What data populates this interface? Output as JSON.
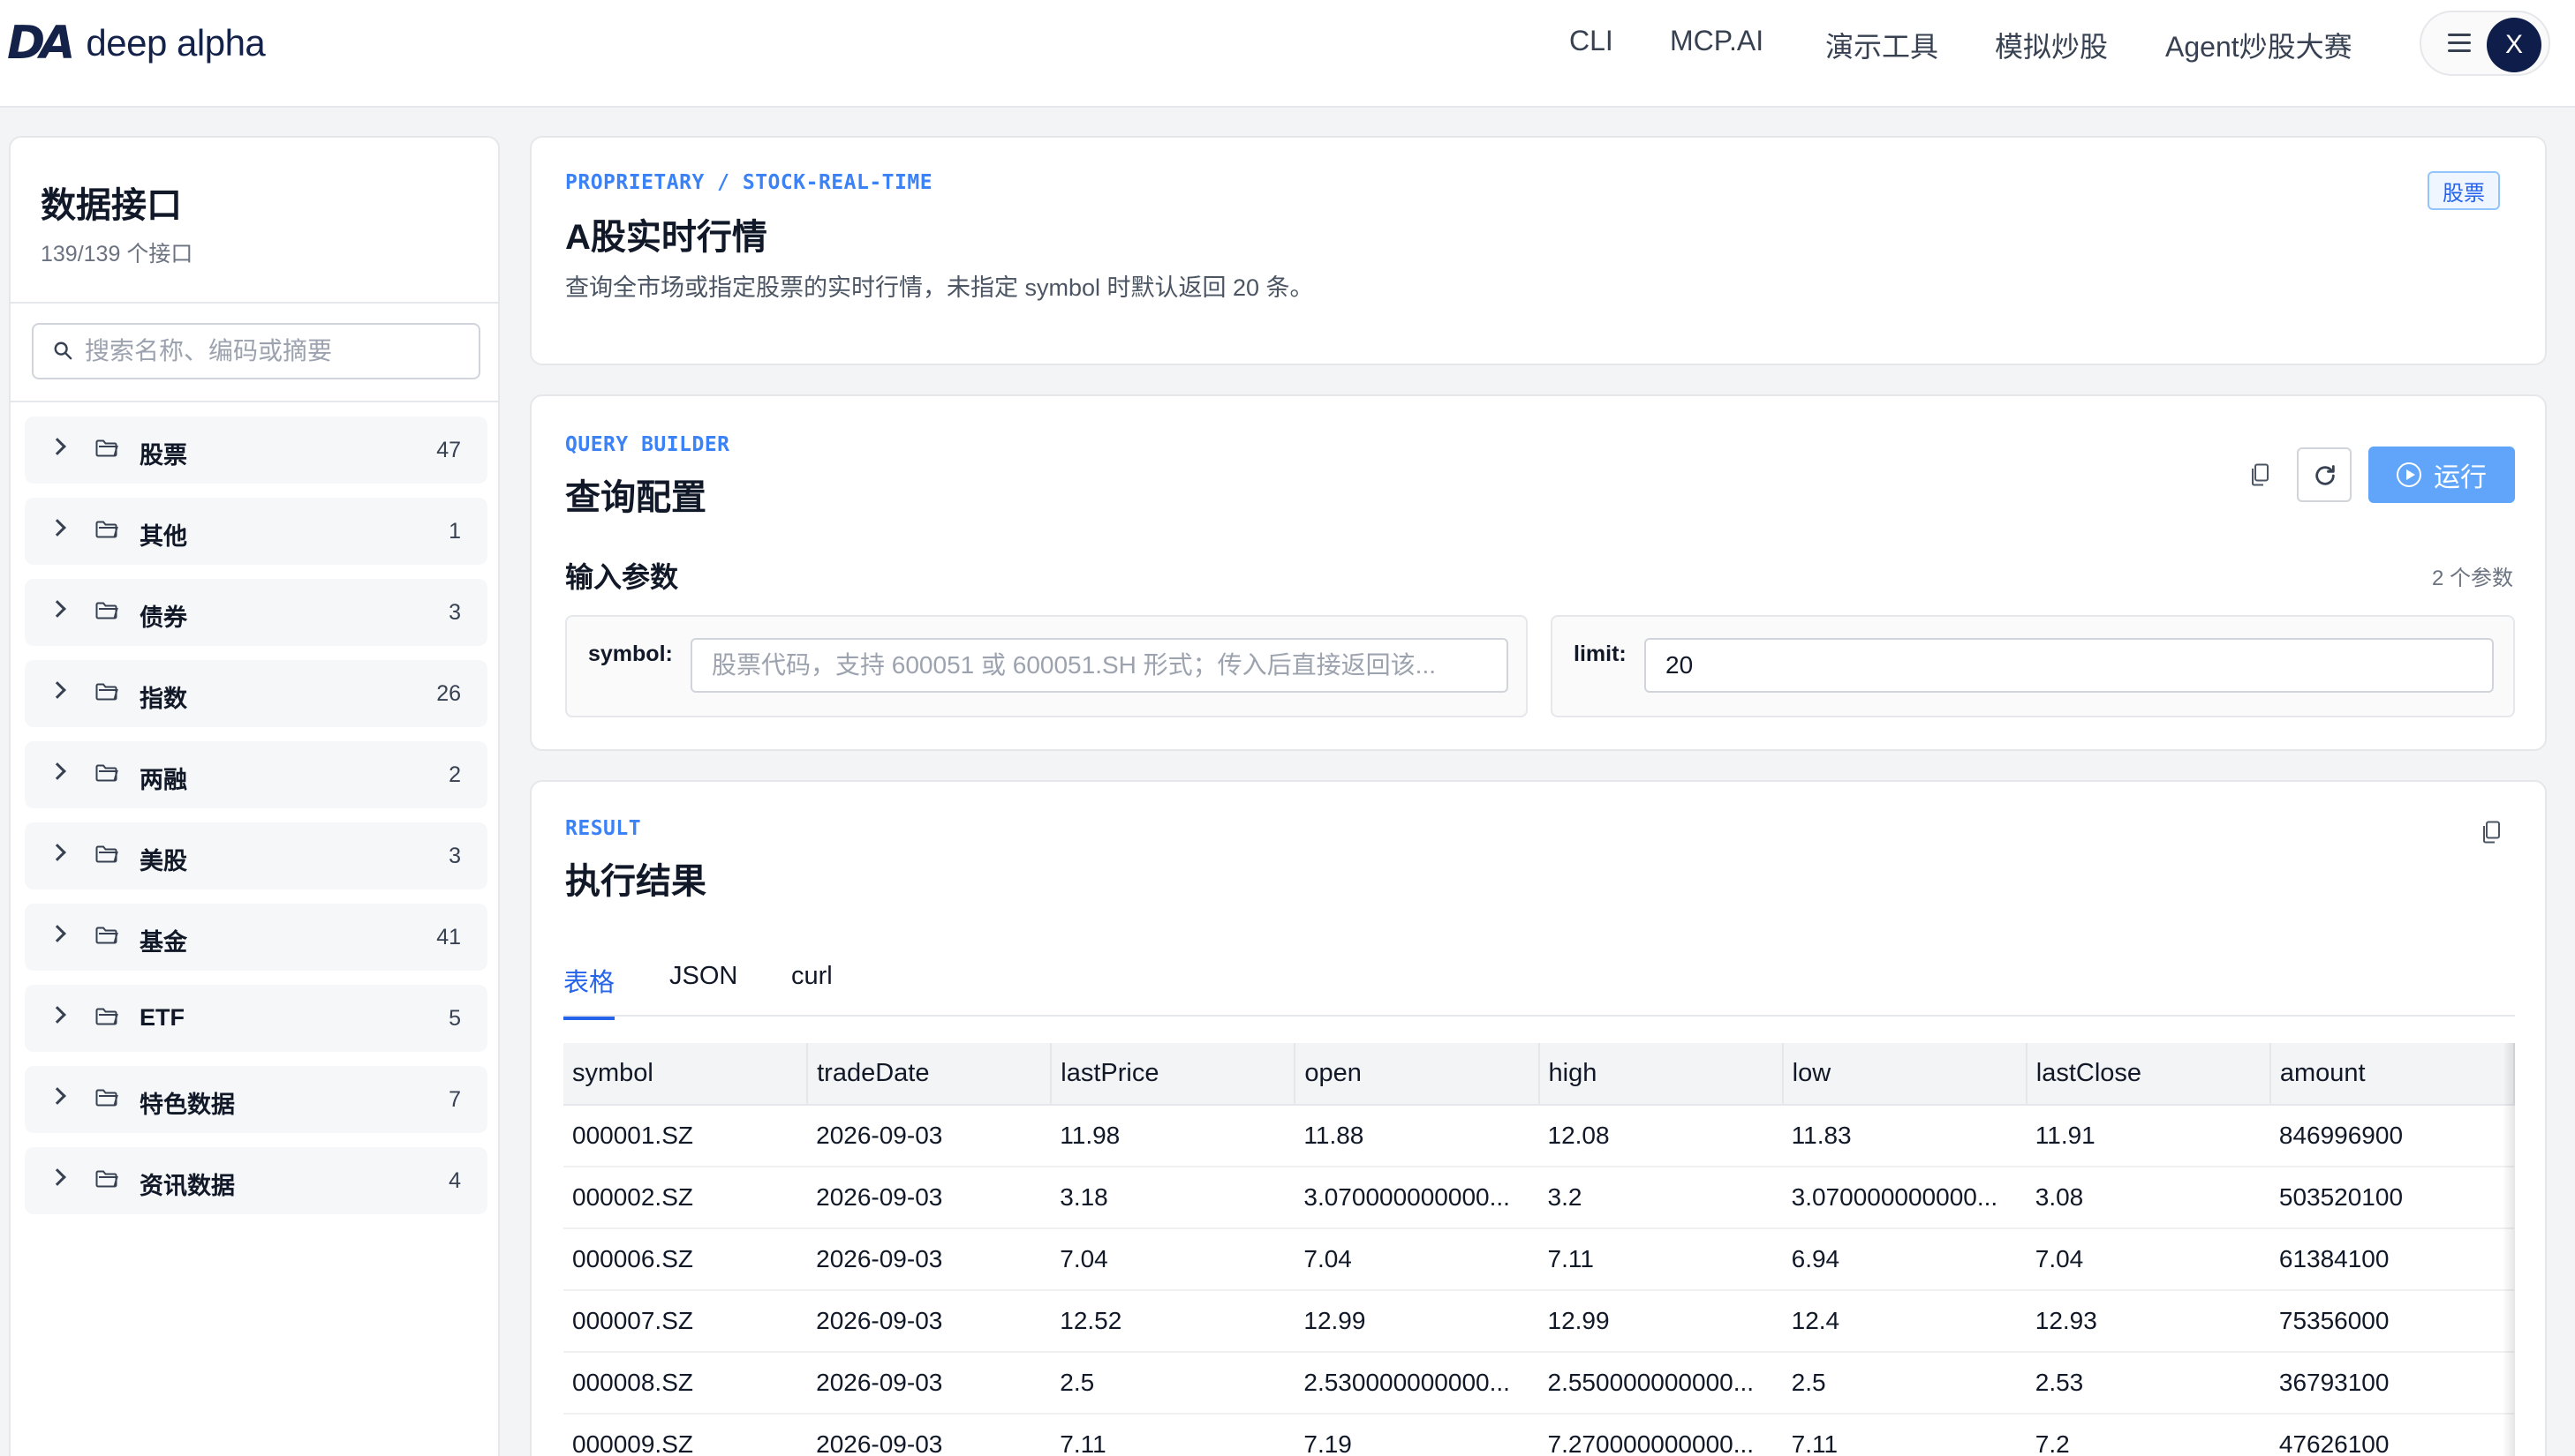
{
  "header": {
    "logo_mark": "DA",
    "logo_text": "deep alpha",
    "nav": [
      "CLI",
      "MCP.AI",
      "演示工具",
      "模拟炒股",
      "Agent炒股大赛"
    ],
    "avatar_initial": "X"
  },
  "sidebar": {
    "title": "数据接口",
    "count": "139/139 个接口",
    "search_placeholder": "搜索名称、编码或摘要",
    "categories": [
      {
        "label": "股票",
        "count": "47"
      },
      {
        "label": "其他",
        "count": "1"
      },
      {
        "label": "债券",
        "count": "3"
      },
      {
        "label": "指数",
        "count": "26"
      },
      {
        "label": "两融",
        "count": "2"
      },
      {
        "label": "美股",
        "count": "3"
      },
      {
        "label": "基金",
        "count": "41"
      },
      {
        "label": "ETF",
        "count": "5"
      },
      {
        "label": "特色数据",
        "count": "7"
      },
      {
        "label": "资讯数据",
        "count": "4"
      }
    ]
  },
  "endpoint": {
    "path": "PROPRIETARY / STOCK-REAL-TIME",
    "title": "A股实时行情",
    "description": "查询全市场或指定股票的实时行情，未指定 symbol 时默认返回 20 条。",
    "badge": "股票"
  },
  "query": {
    "eyebrow": "QUERY BUILDER",
    "title": "查询配置",
    "run_label": "运行",
    "params_label": "输入参数",
    "params_count": "2 个参数",
    "params": [
      {
        "label": "symbol:",
        "value": "",
        "placeholder": "股票代码，支持 600051 或 600051.SH 形式；传入后直接返回该..."
      },
      {
        "label": "limit:",
        "value": "20",
        "placeholder": ""
      }
    ]
  },
  "result": {
    "eyebrow": "RESULT",
    "title": "执行结果",
    "tabs": [
      "表格",
      "JSON",
      "curl"
    ],
    "active_tab": 0,
    "columns": [
      "symbol",
      "tradeDate",
      "lastPrice",
      "open",
      "high",
      "low",
      "lastClose",
      "amount"
    ],
    "rows": [
      [
        "000001.SZ",
        "2026-09-03",
        "11.98",
        "11.88",
        "12.08",
        "11.83",
        "11.91",
        "846996900"
      ],
      [
        "000002.SZ",
        "2026-09-03",
        "3.18",
        "3.070000000000...",
        "3.2",
        "3.070000000000...",
        "3.08",
        "503520100"
      ],
      [
        "000006.SZ",
        "2026-09-03",
        "7.04",
        "7.04",
        "7.11",
        "6.94",
        "7.04",
        "61384100"
      ],
      [
        "000007.SZ",
        "2026-09-03",
        "12.52",
        "12.99",
        "12.99",
        "12.4",
        "12.93",
        "75356000"
      ],
      [
        "000008.SZ",
        "2026-09-03",
        "2.5",
        "2.530000000000...",
        "2.550000000000...",
        "2.5",
        "2.53",
        "36793100"
      ],
      [
        "000009.SZ",
        "2026-09-03",
        "7.11",
        "7.19",
        "7.270000000000...",
        "7.11",
        "7.2",
        "47626100"
      ]
    ]
  },
  "colors": {
    "accent": "#3b82f6",
    "run_button": "#60a5fa",
    "brand": "#14224a"
  }
}
